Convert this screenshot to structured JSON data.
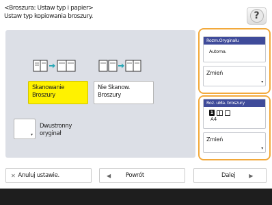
{
  "header": {
    "title_line1": "<Broszura: Ustaw typ i papier>",
    "title_line2": "Ustaw typ kopiowania broszury.",
    "help_icon": "question-mark-icon",
    "help_glyph": "?"
  },
  "scan_options": {
    "scan_booklet": {
      "line1": "Skanowanie",
      "line2": "Broszury",
      "selected": true,
      "icon": "booklet-to-book-icon"
    },
    "no_scan": {
      "line1": "Nie Skanow.",
      "line2": "Broszury",
      "selected": false,
      "icon": "pages-to-book-icon"
    }
  },
  "duplex": {
    "line1": "Dwustronny",
    "line2": "oryginał"
  },
  "original_size": {
    "header": "Rozm.Oryginału",
    "value": "Automa.",
    "change_label": "Zmień"
  },
  "booklet_paper": {
    "header": "Roz. ukła. broszury",
    "binding_number": "1",
    "paper_size": "A4",
    "change_label": "Zmień"
  },
  "footer": {
    "cancel_label": "Anuluj ustawie.",
    "back_label": "Powrót",
    "next_label": "Dalej"
  },
  "colors": {
    "selected_yellow": "#fff200",
    "panel_header_blue": "#3f4b9a",
    "highlight_orange": "#f2a93b",
    "panel_gray": "#dcdfe6",
    "icon_teal": "#2aa8b6"
  }
}
